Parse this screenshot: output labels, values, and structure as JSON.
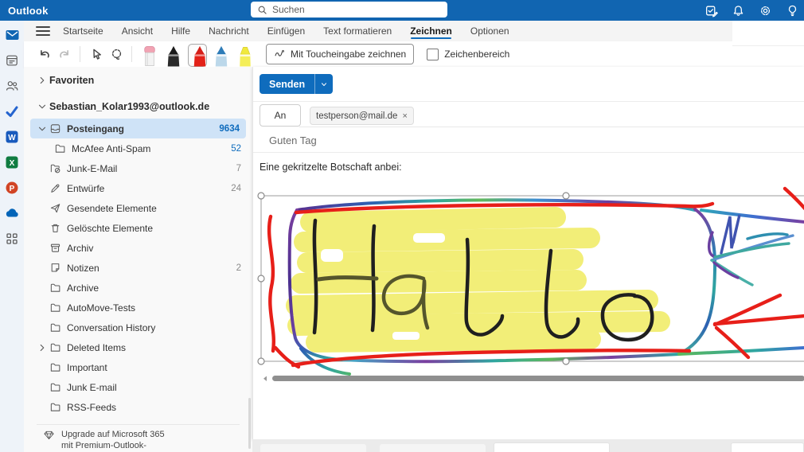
{
  "topbar": {
    "app_name": "Outlook",
    "search_placeholder": "Suchen",
    "icons": [
      {
        "name": "tasks-icon"
      },
      {
        "name": "notifications-icon"
      },
      {
        "name": "settings-icon"
      },
      {
        "name": "tips-icon"
      }
    ]
  },
  "ribbon": {
    "tabs": [
      {
        "label": "Startseite",
        "active": false
      },
      {
        "label": "Ansicht",
        "active": false
      },
      {
        "label": "Hilfe",
        "active": false
      },
      {
        "label": "Nachricht",
        "active": false
      },
      {
        "label": "Einfügen",
        "active": false
      },
      {
        "label": "Text formatieren",
        "active": false
      },
      {
        "label": "Zeichnen",
        "active": true
      },
      {
        "label": "Optionen",
        "active": false
      }
    ],
    "toolbar": {
      "tools": [
        {
          "name": "undo-button",
          "icon": "undo",
          "enabled": true
        },
        {
          "name": "redo-button",
          "icon": "redo",
          "enabled": false
        },
        {
          "name": "select-tool-button",
          "icon": "select",
          "enabled": true
        },
        {
          "name": "lasso-tool-button",
          "icon": "lasso",
          "enabled": true
        }
      ],
      "pens": [
        {
          "name": "eraser-tool",
          "icon": "eraser",
          "selected": false
        },
        {
          "name": "black-pen-tool",
          "icon": "pen-black",
          "selected": false
        },
        {
          "name": "red-pen-tool",
          "icon": "pen-red",
          "selected": true
        },
        {
          "name": "blue-pencil-tool",
          "icon": "pen-blue",
          "selected": false
        },
        {
          "name": "yellow-highlighter-tool",
          "icon": "highlighter",
          "selected": false
        }
      ],
      "touch_button_label": "Mit Toucheingabe zeichnen",
      "canvas_checkbox_label": "Zeichenbereich",
      "canvas_checkbox_checked": false
    }
  },
  "rail": {
    "items": [
      {
        "name": "mail-icon",
        "icon": "mail",
        "active": true
      },
      {
        "name": "calendar-icon",
        "icon": "calendar",
        "active": false
      },
      {
        "name": "people-icon",
        "icon": "people",
        "active": false
      },
      {
        "name": "todo-icon",
        "icon": "todo",
        "active": false
      },
      {
        "name": "word-icon",
        "icon": "word",
        "active": false
      },
      {
        "name": "excel-icon",
        "icon": "excel",
        "active": false
      },
      {
        "name": "powerpoint-icon",
        "icon": "ppt",
        "active": false
      },
      {
        "name": "onedrive-icon",
        "icon": "onedrive",
        "active": false
      },
      {
        "name": "apps-icon",
        "icon": "apps",
        "active": false
      }
    ]
  },
  "sidebar": {
    "favorites_label": "Favoriten",
    "account_label": "Sebastian_Kolar1993@outlook.de",
    "folders": [
      {
        "label": "Posteingang",
        "count": "9634",
        "icon": "inbox",
        "chevron": "down",
        "selected": true,
        "count_blue": true,
        "indent": 0
      },
      {
        "label": "McAfee Anti-Spam",
        "count": "52",
        "icon": "folder",
        "chevron": "",
        "selected": false,
        "count_blue": true,
        "indent": 1
      },
      {
        "label": "Junk-E-Mail",
        "count": "7",
        "icon": "junk",
        "chevron": "",
        "selected": false,
        "count_blue": false,
        "indent": 0
      },
      {
        "label": "Entwürfe",
        "count": "24",
        "icon": "drafts",
        "chevron": "",
        "selected": false,
        "count_blue": false,
        "indent": 0
      },
      {
        "label": "Gesendete Elemente",
        "count": "",
        "icon": "sent",
        "chevron": "",
        "selected": false,
        "count_blue": false,
        "indent": 0
      },
      {
        "label": "Gelöschte Elemente",
        "count": "",
        "icon": "trash",
        "chevron": "",
        "selected": false,
        "count_blue": false,
        "indent": 0
      },
      {
        "label": "Archiv",
        "count": "",
        "icon": "archive",
        "chevron": "",
        "selected": false,
        "count_blue": false,
        "indent": 0
      },
      {
        "label": "Notizen",
        "count": "2",
        "icon": "note",
        "chevron": "",
        "selected": false,
        "count_blue": false,
        "indent": 0
      },
      {
        "label": "Archive",
        "count": "",
        "icon": "folder",
        "chevron": "",
        "selected": false,
        "count_blue": false,
        "indent": 0
      },
      {
        "label": "AutoMove-Tests",
        "count": "",
        "icon": "folder",
        "chevron": "",
        "selected": false,
        "count_blue": false,
        "indent": 0
      },
      {
        "label": "Conversation History",
        "count": "",
        "icon": "folder",
        "chevron": "",
        "selected": false,
        "count_blue": false,
        "indent": 0
      },
      {
        "label": "Deleted Items",
        "count": "",
        "icon": "folder",
        "chevron": "right",
        "selected": false,
        "count_blue": false,
        "indent": 0
      },
      {
        "label": "Important",
        "count": "",
        "icon": "folder",
        "chevron": "",
        "selected": false,
        "count_blue": false,
        "indent": 0
      },
      {
        "label": "Junk E-mail",
        "count": "",
        "icon": "folder",
        "chevron": "",
        "selected": false,
        "count_blue": false,
        "indent": 0
      },
      {
        "label": "RSS-Feeds",
        "count": "",
        "icon": "folder",
        "chevron": "",
        "selected": false,
        "count_blue": false,
        "indent": 0
      }
    ],
    "upgrade_line1": "Upgrade auf Microsoft 365",
    "upgrade_line2": "mit Premium-Outlook-"
  },
  "compose": {
    "send_label": "Senden",
    "to_label": "An",
    "recipient": "testperson@mail.de",
    "recipient_remove": "×",
    "subject": "Guten Tag",
    "body": "Eine gekritzelte Botschaft anbei:",
    "canvas_word": "Hallo"
  },
  "colors": {
    "topbar_blue": "#1165b1",
    "accent_blue": "#0f6cbd",
    "selected_row": "#cfe3f7",
    "ink_black": "#1f1f1f",
    "highlighter_yellow": "#f2ee78",
    "pen_red": "#e71f19"
  }
}
